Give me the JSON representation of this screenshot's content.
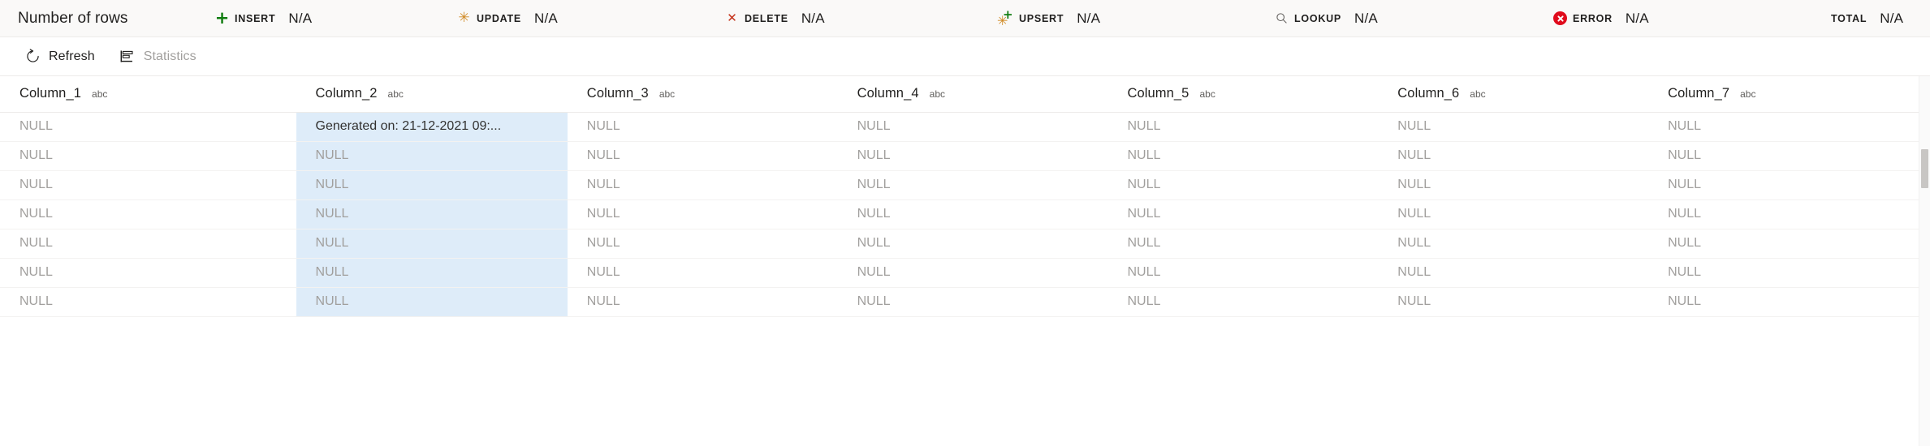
{
  "stats_bar": {
    "title": "Number of rows",
    "items": [
      {
        "icon": "plus-icon",
        "label": "INSERT",
        "value": "N/A"
      },
      {
        "icon": "asterisk-icon",
        "label": "UPDATE",
        "value": "N/A"
      },
      {
        "icon": "x-icon",
        "label": "DELETE",
        "value": "N/A"
      },
      {
        "icon": "upsert-icon",
        "label": "UPSERT",
        "value": "N/A"
      },
      {
        "icon": "search-icon",
        "label": "LOOKUP",
        "value": "N/A"
      },
      {
        "icon": "error-icon",
        "label": "ERROR",
        "value": "N/A"
      },
      {
        "icon": "none",
        "label": "TOTAL",
        "value": "N/A"
      }
    ],
    "colors": {
      "insert_green": "#107c10",
      "update_orange": "#d08a24",
      "delete_red": "#c4321a",
      "error_red": "#e00b1c",
      "background": "#faf9f8"
    }
  },
  "toolbar": {
    "refresh_label": "Refresh",
    "refresh_icon": "refresh-icon",
    "statistics_label": "Statistics",
    "statistics_icon": "statistics-icon",
    "statistics_disabled": true
  },
  "grid": {
    "type_indicator": "abc",
    "selected_column": "Column_2",
    "selection_color": "#deecf9",
    "columns": [
      {
        "name": "Column_1",
        "type": "abc"
      },
      {
        "name": "Column_2",
        "type": "abc"
      },
      {
        "name": "Column_3",
        "type": "abc"
      },
      {
        "name": "Column_4",
        "type": "abc"
      },
      {
        "name": "Column_5",
        "type": "abc"
      },
      {
        "name": "Column_6",
        "type": "abc"
      },
      {
        "name": "Column_7",
        "type": "abc"
      }
    ],
    "null_text": "NULL",
    "rows": [
      [
        "NULL",
        "Generated on: 21-12-2021 09:...",
        "NULL",
        "NULL",
        "NULL",
        "NULL",
        "NULL"
      ],
      [
        "NULL",
        "NULL",
        "NULL",
        "NULL",
        "NULL",
        "NULL",
        "NULL"
      ],
      [
        "NULL",
        "NULL",
        "NULL",
        "NULL",
        "NULL",
        "NULL",
        "NULL"
      ],
      [
        "NULL",
        "NULL",
        "NULL",
        "NULL",
        "NULL",
        "NULL",
        "NULL"
      ],
      [
        "NULL",
        "NULL",
        "NULL",
        "NULL",
        "NULL",
        "NULL",
        "NULL"
      ],
      [
        "NULL",
        "NULL",
        "NULL",
        "NULL",
        "NULL",
        "NULL",
        "NULL"
      ],
      [
        "NULL",
        "NULL",
        "NULL",
        "NULL",
        "NULL",
        "NULL",
        "NULL"
      ]
    ]
  }
}
